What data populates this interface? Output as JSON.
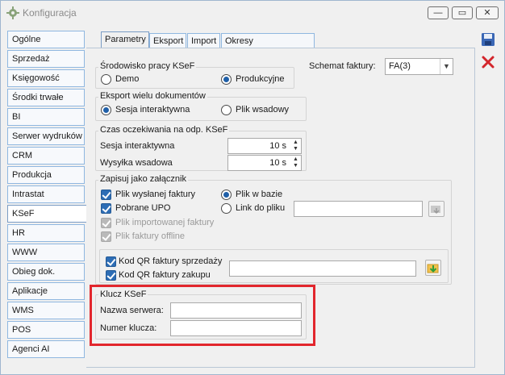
{
  "window": {
    "title": "Konfiguracja"
  },
  "nav": [
    "Ogólne",
    "Sprzedaż",
    "Księgowość",
    "Środki trwałe",
    "BI",
    "Serwer wydruków",
    "CRM",
    "Produkcja",
    "Intrastat",
    "KSeF",
    "HR",
    "WWW",
    "Obieg dok.",
    "Aplikacje",
    "WMS",
    "POS",
    "Agenci AI"
  ],
  "tabs": [
    "Parametry",
    "Eksport",
    "Import",
    "Okresy niedostępności"
  ],
  "env": {
    "title": "Środowisko pracy KSeF",
    "demo": "Demo",
    "prod": "Produkcyjne"
  },
  "schema": {
    "label": "Schemat faktury:",
    "value": "FA(3)"
  },
  "export": {
    "title": "Eksport wielu dokumentów",
    "interactive": "Sesja interaktywna",
    "batch": "Plik wsadowy"
  },
  "timeout": {
    "title": "Czas oczekiwania na odp. KSeF",
    "session_label": "Sesja interaktywna",
    "session_value": "10 s",
    "send_label": "Wysyłka wsadowa",
    "send_value": "10 s"
  },
  "attach": {
    "title": "Zapisuj jako załącznik",
    "sent": "Plik wysłanej faktury",
    "upo": "Pobrane UPO",
    "imported": "Plik importowanej faktury",
    "offline": "Plik faktury offline",
    "in_db": "Plik w bazie",
    "link": "Link do pliku",
    "qr_sale": "Kod QR faktury sprzedaży",
    "qr_buy": "Kod QR faktury zakupu"
  },
  "key": {
    "title": "Klucz KSeF",
    "server_label": "Nazwa serwera:",
    "number_label": "Numer klucza:"
  },
  "colors": {
    "accent": "#2d6db5",
    "highlight": "#e2262d"
  }
}
